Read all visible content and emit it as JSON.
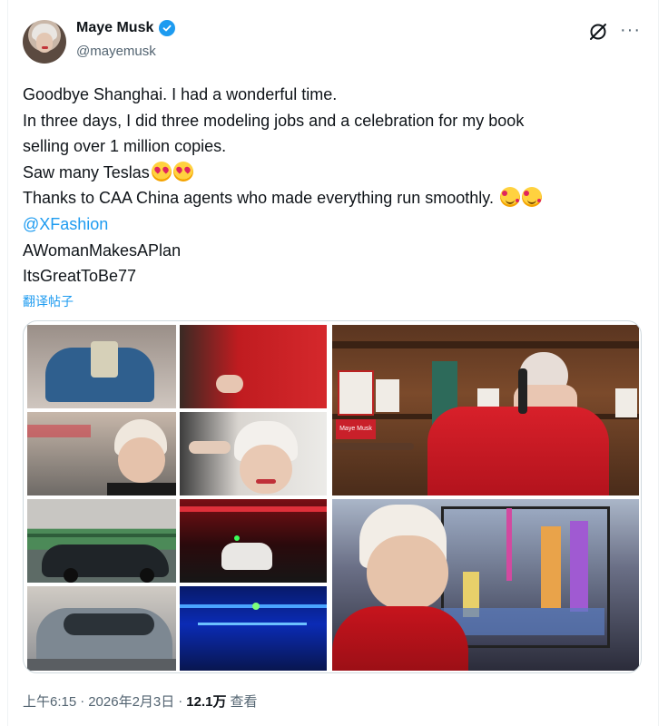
{
  "author": {
    "name": "Maye Musk",
    "handle": "@mayemusk",
    "verified": true
  },
  "icons": {
    "verified": "verified-badge-icon",
    "grok": "grok-icon",
    "more": "more-options-icon",
    "emoji_heart_eyes": "heart-eyes-emoji",
    "emoji_smiling_hearts": "smiling-face-with-hearts-emoji"
  },
  "tweet": {
    "line1": "Goodbye Shanghai. I had a wonderful time.",
    "line2": "In three days, I did three modeling jobs and a celebration for my book",
    "line3": "selling over 1 million copies.",
    "line4": "Saw many Teslas",
    "line5": "Thanks to CAA China agents who made everything run smoothly.",
    "mention": "@XFashion",
    "tag1": "AWomanMakesAPlan",
    "tag2": "ItsGreatToBe77"
  },
  "translate_label": "翻译帖子",
  "media": {
    "photos": [
      "woman-in-blue-coat-photo",
      "red-jacket-photo",
      "book-signing-photo",
      "car-window-portrait-photo",
      "hair-styling-photo",
      "tesla-on-bridge-photo",
      "red-lit-tunnel-photo",
      "shanghai-skyline-portrait-photo",
      "parked-tesla-photo",
      "blue-lit-bridge-photo"
    ],
    "book_sign_text": "Maye Musk"
  },
  "footer": {
    "time": "上午6:15",
    "separator": "·",
    "date": "2026年2月3日",
    "views_count": "12.1万",
    "views_label": "查看"
  },
  "colors": {
    "link": "#1d9bf0",
    "secondary_text": "#536471",
    "primary_text": "#0f1419",
    "border": "#cfd9de"
  }
}
